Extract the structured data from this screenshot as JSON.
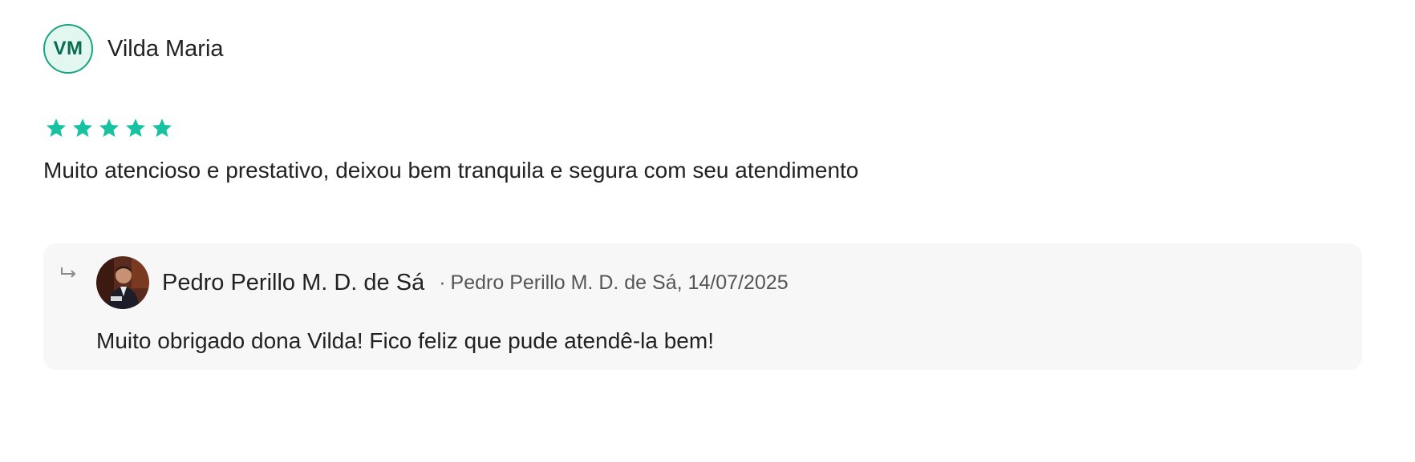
{
  "review": {
    "author_initials": "VM",
    "author_name": "Vilda Maria",
    "rating": 5,
    "rating_max": 5,
    "text": "Muito atencioso e prestativo, deixou bem tranquila e segura com seu atendimento"
  },
  "reply": {
    "author_name": "Pedro Perillo M. D. de Sá",
    "meta_separator": "·",
    "meta": "Pedro Perillo M. D. de Sá, 14/07/2025",
    "text": "Muito obrigado dona Vilda! Fico feliz que pude atendê-la bem!",
    "icon": "reply-arrow-icon"
  },
  "colors": {
    "star": "#16c2a0",
    "avatar_border": "#1aa37f",
    "avatar_bg": "#e3f7f1",
    "avatar_text": "#0b6b52",
    "reply_bg": "#f7f7f7"
  }
}
